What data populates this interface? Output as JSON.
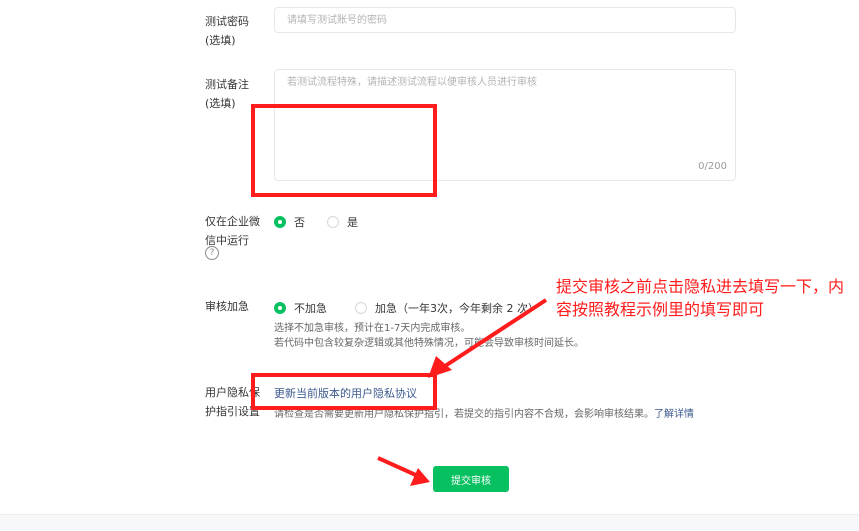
{
  "test_password": {
    "label_line1": "测试密码",
    "label_line2": "(选填)",
    "placeholder": "请填写测试账号的密码"
  },
  "test_note": {
    "label_line1": "测试备注",
    "label_line2": "(选填)",
    "placeholder": "若测试流程特殊，请描述测试流程以便审核人员进行审核",
    "counter": "0/200"
  },
  "wecom_only": {
    "label_line1": "仅在企业微",
    "label_line2": "信中运行",
    "help_icon": "?",
    "options": [
      {
        "label": "否",
        "checked": true
      },
      {
        "label": "是",
        "checked": false
      }
    ]
  },
  "expedite": {
    "label": "审核加急",
    "options": [
      {
        "label": "不加急",
        "checked": true
      },
      {
        "label": "加急（一年3次，今年剩余 2 次）",
        "checked": false
      }
    ],
    "hint_line1": "选择不加急审核，预计在1-7天内完成审核。",
    "hint_line2": "若代码中包含较复杂逻辑或其他特殊情况，可能会导致审核时间延长。"
  },
  "privacy": {
    "label_line1": "用户隐私保",
    "label_line2": "护指引设置",
    "update_link": "更新当前版本的用户隐私协议",
    "hint": "请检查是否需要更新用户隐私保护指引，若提交的指引内容不合规，会影响审核结果。",
    "more_link": "了解详情"
  },
  "submit_label": "提交审核",
  "annotation": {
    "text": "提交审核之前点击隐私进去填写一下，内容按照教程示例里的填写即可",
    "color": "#ff1c1c"
  },
  "colors": {
    "accent": "#07c160",
    "link": "#3c5a8e"
  }
}
